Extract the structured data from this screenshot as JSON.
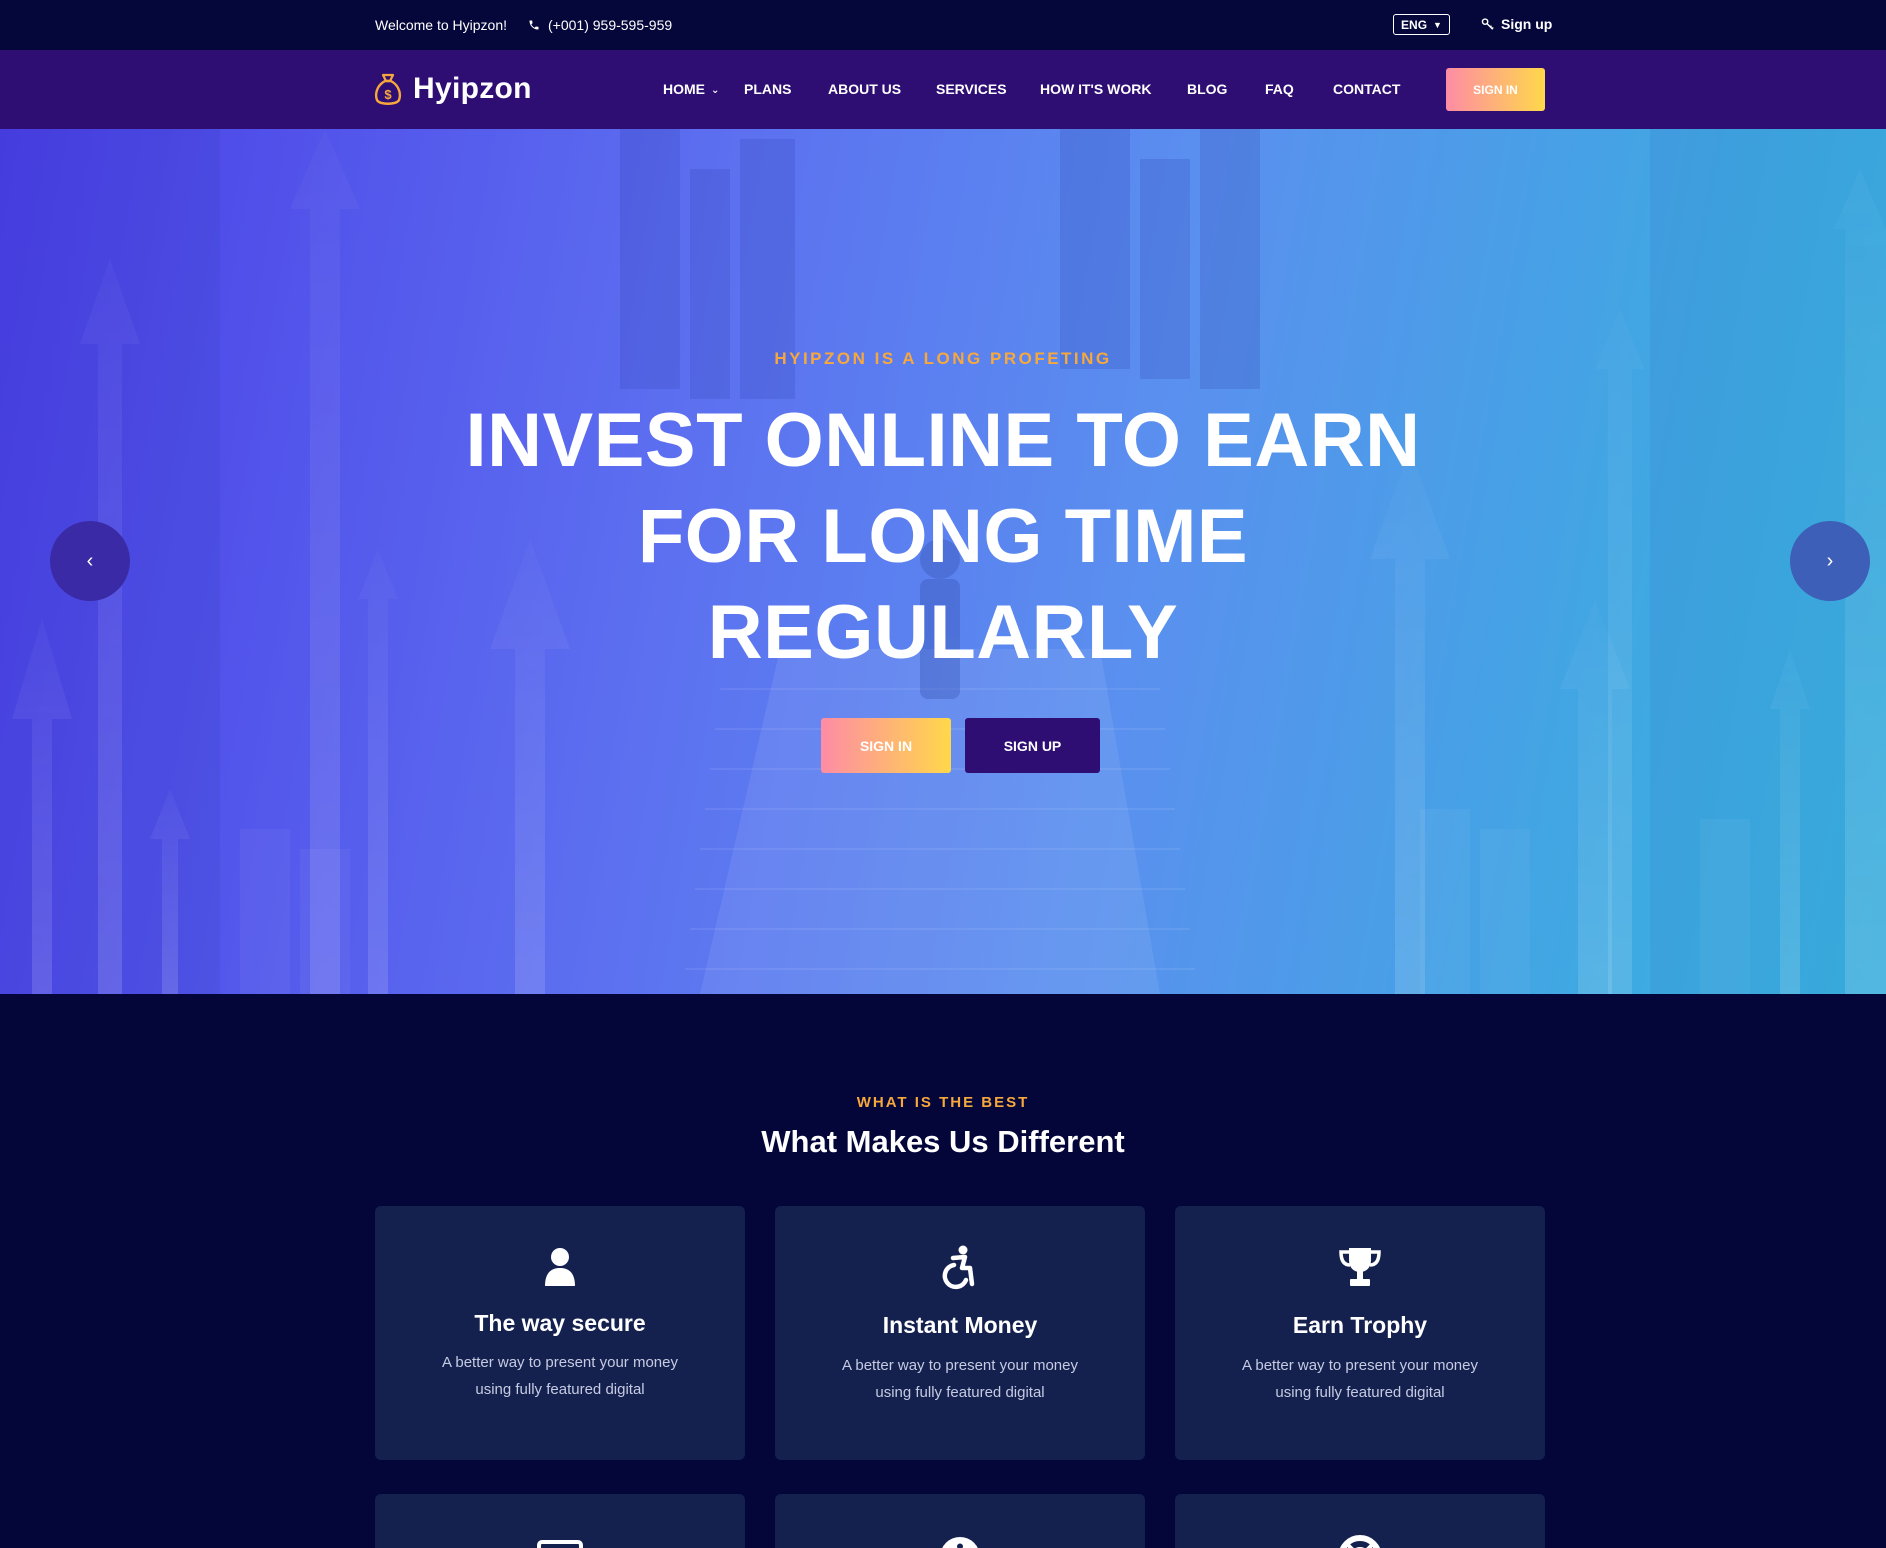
{
  "topbar": {
    "welcome": "Welcome to Hyipzon!",
    "phone": "(+001) 959-595-959",
    "language": "ENG",
    "signup": "Sign up"
  },
  "navbar": {
    "brand": "Hyipzon",
    "items": [
      {
        "label": "HOME"
      },
      {
        "label": "PLANS"
      },
      {
        "label": "ABOUT US"
      },
      {
        "label": "SERVICES"
      },
      {
        "label": "HOW IT'S WORK"
      },
      {
        "label": "BLOG"
      },
      {
        "label": "FAQ"
      },
      {
        "label": "CONTACT"
      }
    ],
    "signin": "SIGN IN"
  },
  "hero": {
    "kicker": "HYIPZON IS A LONG PROFETING",
    "headline": "INVEST ONLINE TO EARN FOR LONG TIME REGULARLY",
    "signin": "SIGN IN",
    "signup": "SIGN UP",
    "prev": "‹",
    "next": "›"
  },
  "features": {
    "kicker": "WHAT IS THE BEST",
    "title": "What Makes Us Different",
    "cards": [
      {
        "icon": "user-icon",
        "title": "The way secure",
        "desc": "A better way to present your money using fully featured digital"
      },
      {
        "icon": "accessibility-icon",
        "title": "Instant Money",
        "desc": "A better way to present your money using fully featured digital"
      },
      {
        "icon": "trophy-icon",
        "title": "Earn Trophy",
        "desc": "A better way to present your money using fully featured digital"
      }
    ]
  },
  "colors": {
    "accent_orange": "#f7a83c",
    "gradient_start": "#fd8ca5",
    "gradient_end": "#ffd84a",
    "nav_bg": "#2f0e74",
    "page_bg": "#04063a",
    "card_bg": "#14214f"
  }
}
